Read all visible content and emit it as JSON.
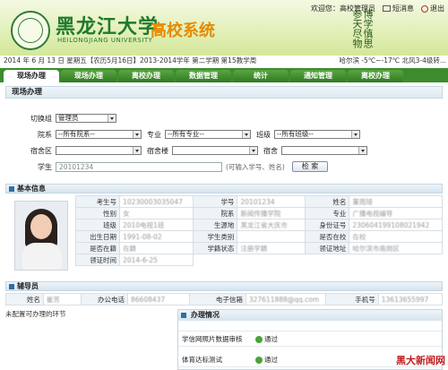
{
  "header": {
    "university_cn": "黑龙江大学",
    "university_en": "HEILONGJIANG UNIVERSITY",
    "system_name": "高校系统",
    "calligraphy": "博学慎思参天尽物",
    "welcome": "欢迎您：高校管理员",
    "short_msg": "短消息",
    "logout": "退出",
    "city": "哈尔滨",
    "weather": "-5℃~-17℃ 北风3-4级转..."
  },
  "datebar": {
    "text": "2014 年 6 月 13 日 星期五【农历5月16日】2013-2014学年 第二学期 第15教学周"
  },
  "nav": {
    "tabs": [
      "现场办理",
      "现场办理",
      "离校办理",
      "数据管理",
      "统计",
      "通知管理",
      "离校办理"
    ]
  },
  "section": {
    "title": "现场办理"
  },
  "filter": {
    "switch_group_label": "切换组",
    "switch_group_value": "管理员",
    "college_label": "院系",
    "college_value": "--所有院系--",
    "major_label": "专业",
    "major_value": "--所有专业--",
    "class_label": "班级",
    "class_value": "--所有班级--",
    "dorm_area_label": "宿舍区",
    "dorm_bldg_label": "宿舍楼",
    "dorm_label": "宿舍",
    "student_label": "学生",
    "student_value": "20101234",
    "student_hint": "(可输入学号、姓名)",
    "search_button": "检 索"
  },
  "basic_info": {
    "title": "基本信息",
    "rows": [
      [
        "考生号",
        "10230003035047",
        "学号",
        "20101234",
        "姓名",
        "董雨琦"
      ],
      [
        "性别",
        "女",
        "院系",
        "新闻传播学院",
        "专业",
        "广播电视编导"
      ],
      [
        "班级",
        "2010电视1班",
        "生源地",
        "黑龙江省大庆市",
        "身份证号",
        "230604199108021942"
      ],
      [
        "出生日期",
        "1991-08-02",
        "学生类别",
        "",
        "是否在校",
        "在校"
      ],
      [
        "是否在籍",
        "在籍",
        "学籍状态",
        "注册学籍",
        "领证地址",
        "哈尔滨市南岗区"
      ],
      [
        "领证时间",
        "2014-6-25",
        "",
        "",
        "",
        ""
      ]
    ]
  },
  "counselor": {
    "title": "辅导员",
    "name_label": "姓名",
    "name_value": "崔芳",
    "phone_label": "办公电话",
    "phone_value": "86608437",
    "email_label": "电子信箱",
    "email_value": "327611888@qq.com",
    "mobile_label": "手机号",
    "mobile_value": "13613655997"
  },
  "left_note": "未配置可办理的环节",
  "progress": {
    "title": "办理情况",
    "items": [
      {
        "name": "学信网照片数据审核",
        "status": "通过"
      },
      {
        "name": "体育达标测试",
        "status": "通过"
      }
    ]
  },
  "watermark": "黑大新闻网"
}
